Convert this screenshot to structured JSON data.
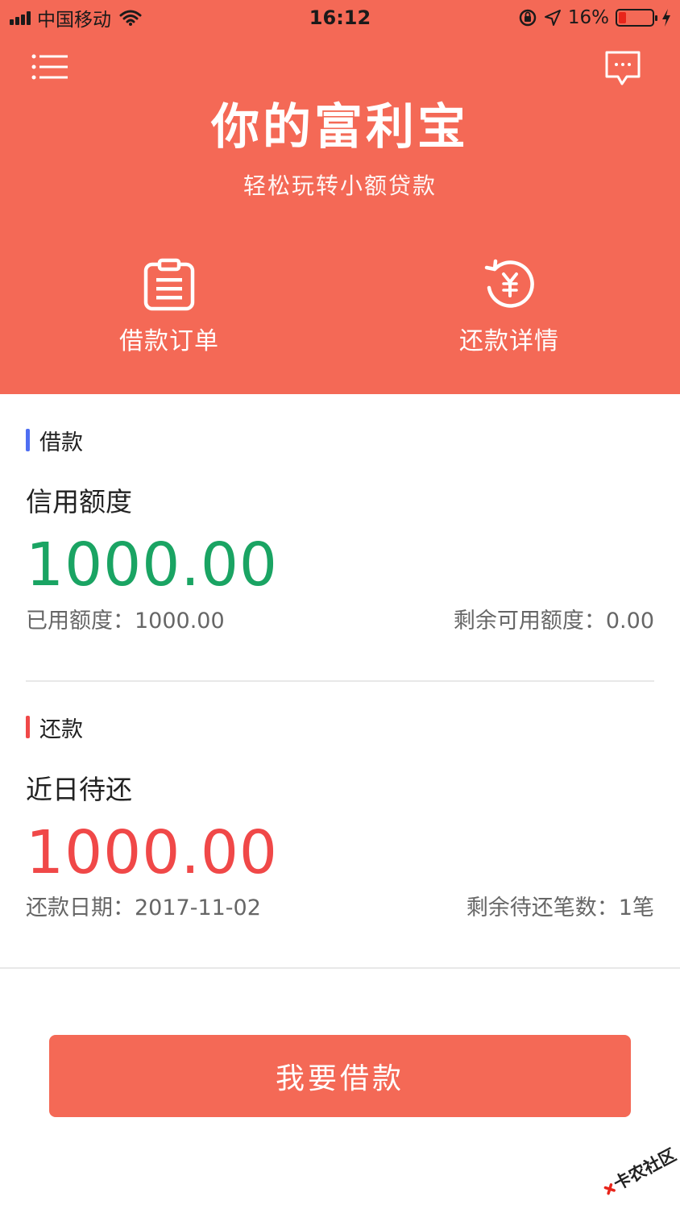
{
  "status_bar": {
    "carrier": "中国移动",
    "time": "16:12",
    "battery_percent": "16%",
    "battery_level": 0.16,
    "battery_color": "#e8251b"
  },
  "header": {
    "background_color": "#f46956",
    "menu_icon": "list-menu-icon",
    "message_icon": "chat-bubble-icon",
    "title": "你的富利宝",
    "subtitle": "轻松玩转小额贷款",
    "actions": [
      {
        "icon": "clipboard-icon",
        "label": "借款订单"
      },
      {
        "icon": "yuan-refresh-icon",
        "label": "还款详情"
      }
    ]
  },
  "borrow_section": {
    "tag": "借款",
    "tag_color": "#4e6ef2",
    "heading": "信用额度",
    "amount": "1000.00",
    "amount_color": "#1aa463",
    "used": "已用额度：1000.00",
    "remaining": "剩余可用额度：0.00"
  },
  "repay_section": {
    "tag": "还款",
    "tag_color": "#f04848",
    "heading": "近日待还",
    "amount": "1000.00",
    "amount_color": "#f04848",
    "due_date": "还款日期：2017-11-02",
    "remaining_count": "剩余待还笔数：1笔"
  },
  "primary_button": {
    "label": "我要借款"
  },
  "watermark": {
    "text": "卡农社区"
  }
}
